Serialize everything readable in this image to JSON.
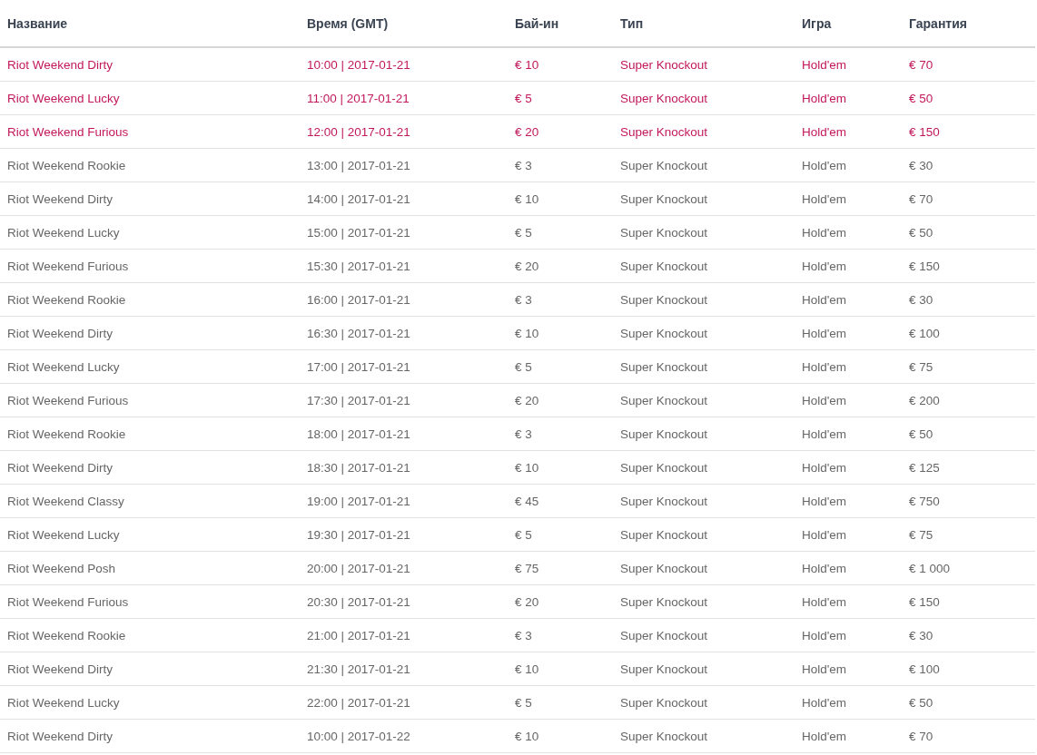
{
  "table": {
    "columns": [
      "Название",
      "Время (GMT)",
      "Бай-ин",
      "Тип",
      "Игра",
      "Гарантия"
    ],
    "rows": [
      {
        "highlighted": true,
        "cells": [
          "Riot Weekend Dirty",
          "10:00 | 2017-01-21",
          "€ 10",
          "Super Knockout",
          "Hold'em",
          "€ 70"
        ]
      },
      {
        "highlighted": true,
        "cells": [
          "Riot Weekend Lucky",
          "11:00 | 2017-01-21",
          "€ 5",
          "Super Knockout",
          "Hold'em",
          "€ 50"
        ]
      },
      {
        "highlighted": true,
        "cells": [
          "Riot Weekend Furious",
          "12:00 | 2017-01-21",
          "€ 20",
          "Super Knockout",
          "Hold'em",
          "€ 150"
        ]
      },
      {
        "highlighted": false,
        "cells": [
          "Riot Weekend Rookie",
          "13:00 | 2017-01-21",
          "€ 3",
          "Super Knockout",
          "Hold'em",
          "€ 30"
        ]
      },
      {
        "highlighted": false,
        "cells": [
          "Riot Weekend Dirty",
          "14:00 | 2017-01-21",
          "€ 10",
          "Super Knockout",
          "Hold'em",
          "€ 70"
        ]
      },
      {
        "highlighted": false,
        "cells": [
          "Riot Weekend Lucky",
          "15:00 | 2017-01-21",
          "€ 5",
          "Super Knockout",
          "Hold'em",
          "€ 50"
        ]
      },
      {
        "highlighted": false,
        "cells": [
          "Riot Weekend Furious",
          "15:30 | 2017-01-21",
          "€ 20",
          "Super Knockout",
          "Hold'em",
          "€ 150"
        ]
      },
      {
        "highlighted": false,
        "cells": [
          "Riot Weekend Rookie",
          "16:00 | 2017-01-21",
          "€ 3",
          "Super Knockout",
          "Hold'em",
          "€ 30"
        ]
      },
      {
        "highlighted": false,
        "cells": [
          "Riot Weekend Dirty",
          "16:30 | 2017-01-21",
          "€ 10",
          "Super Knockout",
          "Hold'em",
          "€ 100"
        ]
      },
      {
        "highlighted": false,
        "cells": [
          "Riot Weekend Lucky",
          "17:00 | 2017-01-21",
          "€ 5",
          "Super Knockout",
          "Hold'em",
          "€ 75"
        ]
      },
      {
        "highlighted": false,
        "cells": [
          "Riot Weekend Furious",
          "17:30 | 2017-01-21",
          "€ 20",
          "Super Knockout",
          "Hold'em",
          "€ 200"
        ]
      },
      {
        "highlighted": false,
        "cells": [
          "Riot Weekend Rookie",
          "18:00 | 2017-01-21",
          "€ 3",
          "Super Knockout",
          "Hold'em",
          "€ 50"
        ]
      },
      {
        "highlighted": false,
        "cells": [
          "Riot Weekend Dirty",
          "18:30 | 2017-01-21",
          "€ 10",
          "Super Knockout",
          "Hold'em",
          "€ 125"
        ]
      },
      {
        "highlighted": false,
        "cells": [
          "Riot Weekend Classy",
          "19:00 | 2017-01-21",
          "€ 45",
          "Super Knockout",
          "Hold'em",
          "€ 750"
        ]
      },
      {
        "highlighted": false,
        "cells": [
          "Riot Weekend Lucky",
          "19:30 | 2017-01-21",
          "€ 5",
          "Super Knockout",
          "Hold'em",
          "€ 75"
        ]
      },
      {
        "highlighted": false,
        "cells": [
          "Riot Weekend Posh",
          "20:00 | 2017-01-21",
          "€ 75",
          "Super Knockout",
          "Hold'em",
          "€ 1 000"
        ]
      },
      {
        "highlighted": false,
        "cells": [
          "Riot Weekend Furious",
          "20:30 | 2017-01-21",
          "€ 20",
          "Super Knockout",
          "Hold'em",
          "€ 150"
        ]
      },
      {
        "highlighted": false,
        "cells": [
          "Riot Weekend Rookie",
          "21:00 | 2017-01-21",
          "€ 3",
          "Super Knockout",
          "Hold'em",
          "€ 30"
        ]
      },
      {
        "highlighted": false,
        "cells": [
          "Riot Weekend Dirty",
          "21:30 | 2017-01-21",
          "€ 10",
          "Super Knockout",
          "Hold'em",
          "€ 100"
        ]
      },
      {
        "highlighted": false,
        "cells": [
          "Riot Weekend Lucky",
          "22:00 | 2017-01-21",
          "€ 5",
          "Super Knockout",
          "Hold'em",
          "€ 50"
        ]
      },
      {
        "highlighted": false,
        "cells": [
          "Riot Weekend Dirty",
          "10:00 | 2017-01-22",
          "€ 10",
          "Super Knockout",
          "Hold'em",
          "€ 70"
        ]
      }
    ]
  }
}
